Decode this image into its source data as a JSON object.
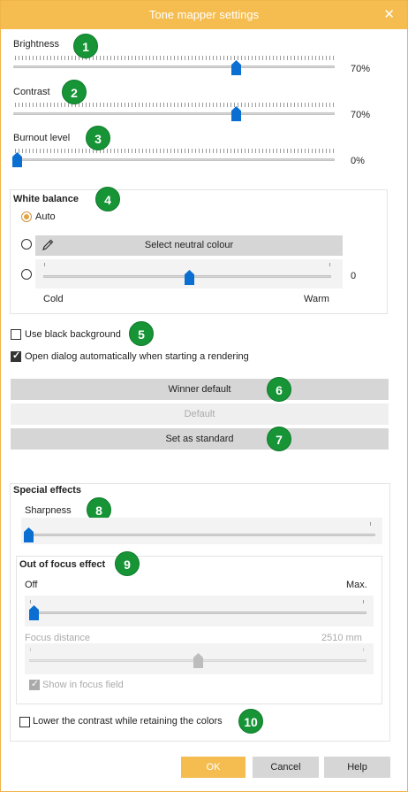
{
  "title": "Tone mapper settings",
  "close_icon": "✕",
  "sliders": {
    "brightness": {
      "label": "Brightness",
      "value": "70%",
      "level": 0.7
    },
    "contrast": {
      "label": "Contrast",
      "value": "70%",
      "level": 0.7
    },
    "burnout": {
      "label": "Burnout level",
      "value": "0%",
      "level": 0.0
    }
  },
  "white_balance": {
    "title": "White balance",
    "auto_label": "Auto",
    "neutral_button": "Select neutral colour",
    "temp_value": "0",
    "cold_label": "Cold",
    "warm_label": "Warm"
  },
  "options": {
    "black_bg": "Use black background",
    "open_dialog": "Open dialog automatically when starting a rendering"
  },
  "buttons": {
    "winner_default": "Winner default",
    "default": "Default",
    "set_standard": "Set as standard"
  },
  "special_effects": {
    "title": "Special effects",
    "sharpness": "Sharpness",
    "focus_title": "Out of focus effect",
    "off_label": "Off",
    "max_label": "Max.",
    "focus_distance": "Focus distance",
    "focus_distance_value": "2510 mm",
    "show_focus_field": "Show in focus field",
    "lower_contrast": "Lower the contrast while retaining the colors"
  },
  "footer": {
    "ok": "OK",
    "cancel": "Cancel",
    "help": "Help"
  },
  "badges": [
    "1",
    "2",
    "3",
    "4",
    "5",
    "6",
    "7",
    "8",
    "9",
    "10"
  ],
  "colors": {
    "titlebar": "#f5bd4f",
    "accent": "#0b6fd1",
    "badge": "#169436",
    "ok_button": "#f5bd4f"
  }
}
